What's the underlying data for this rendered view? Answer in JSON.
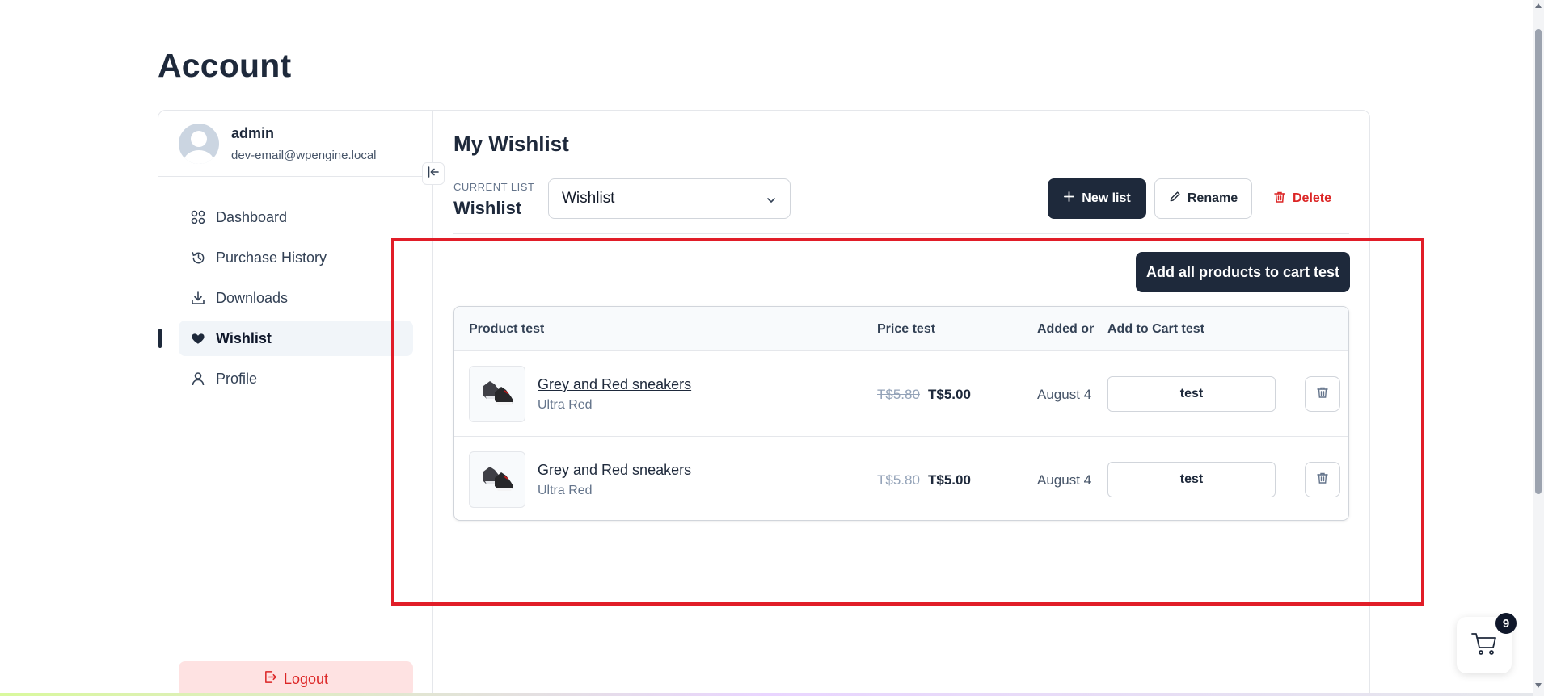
{
  "page": {
    "title": "Account"
  },
  "user": {
    "name": "admin",
    "email": "dev-email@wpengine.local"
  },
  "sidebar": {
    "items": [
      {
        "label": "Dashboard",
        "icon": "dashboard-icon"
      },
      {
        "label": "Purchase History",
        "icon": "history-icon"
      },
      {
        "label": "Downloads",
        "icon": "download-icon"
      },
      {
        "label": "Wishlist",
        "icon": "heart-icon",
        "active": true
      },
      {
        "label": "Profile",
        "icon": "user-icon"
      }
    ],
    "logout_label": "Logout"
  },
  "wishlist": {
    "title": "My Wishlist",
    "current_list_label": "CURRENT LIST",
    "current_list_name": "Wishlist",
    "select_value": "Wishlist",
    "new_list_label": "New list",
    "rename_label": "Rename",
    "delete_label": "Delete",
    "add_all_label": "Add all products to cart test",
    "columns": {
      "product": "Product test",
      "price": "Price test",
      "added": "Added on",
      "cart": "Add to Cart test"
    },
    "rows": [
      {
        "name": "Grey and Red sneakers",
        "variant": "Ultra Red",
        "old_price": "T$5.80",
        "price": "T$5.00",
        "added": "August 4",
        "cart_label": "test"
      },
      {
        "name": "Grey and Red sneakers",
        "variant": "Ultra Red",
        "old_price": "T$5.80",
        "price": "T$5.00",
        "added": "August 4",
        "cart_label": "test"
      }
    ]
  },
  "cart": {
    "count": "9"
  },
  "colors": {
    "accent": "#1e293b",
    "danger": "#dc2626",
    "highlight": "#e11d28"
  }
}
